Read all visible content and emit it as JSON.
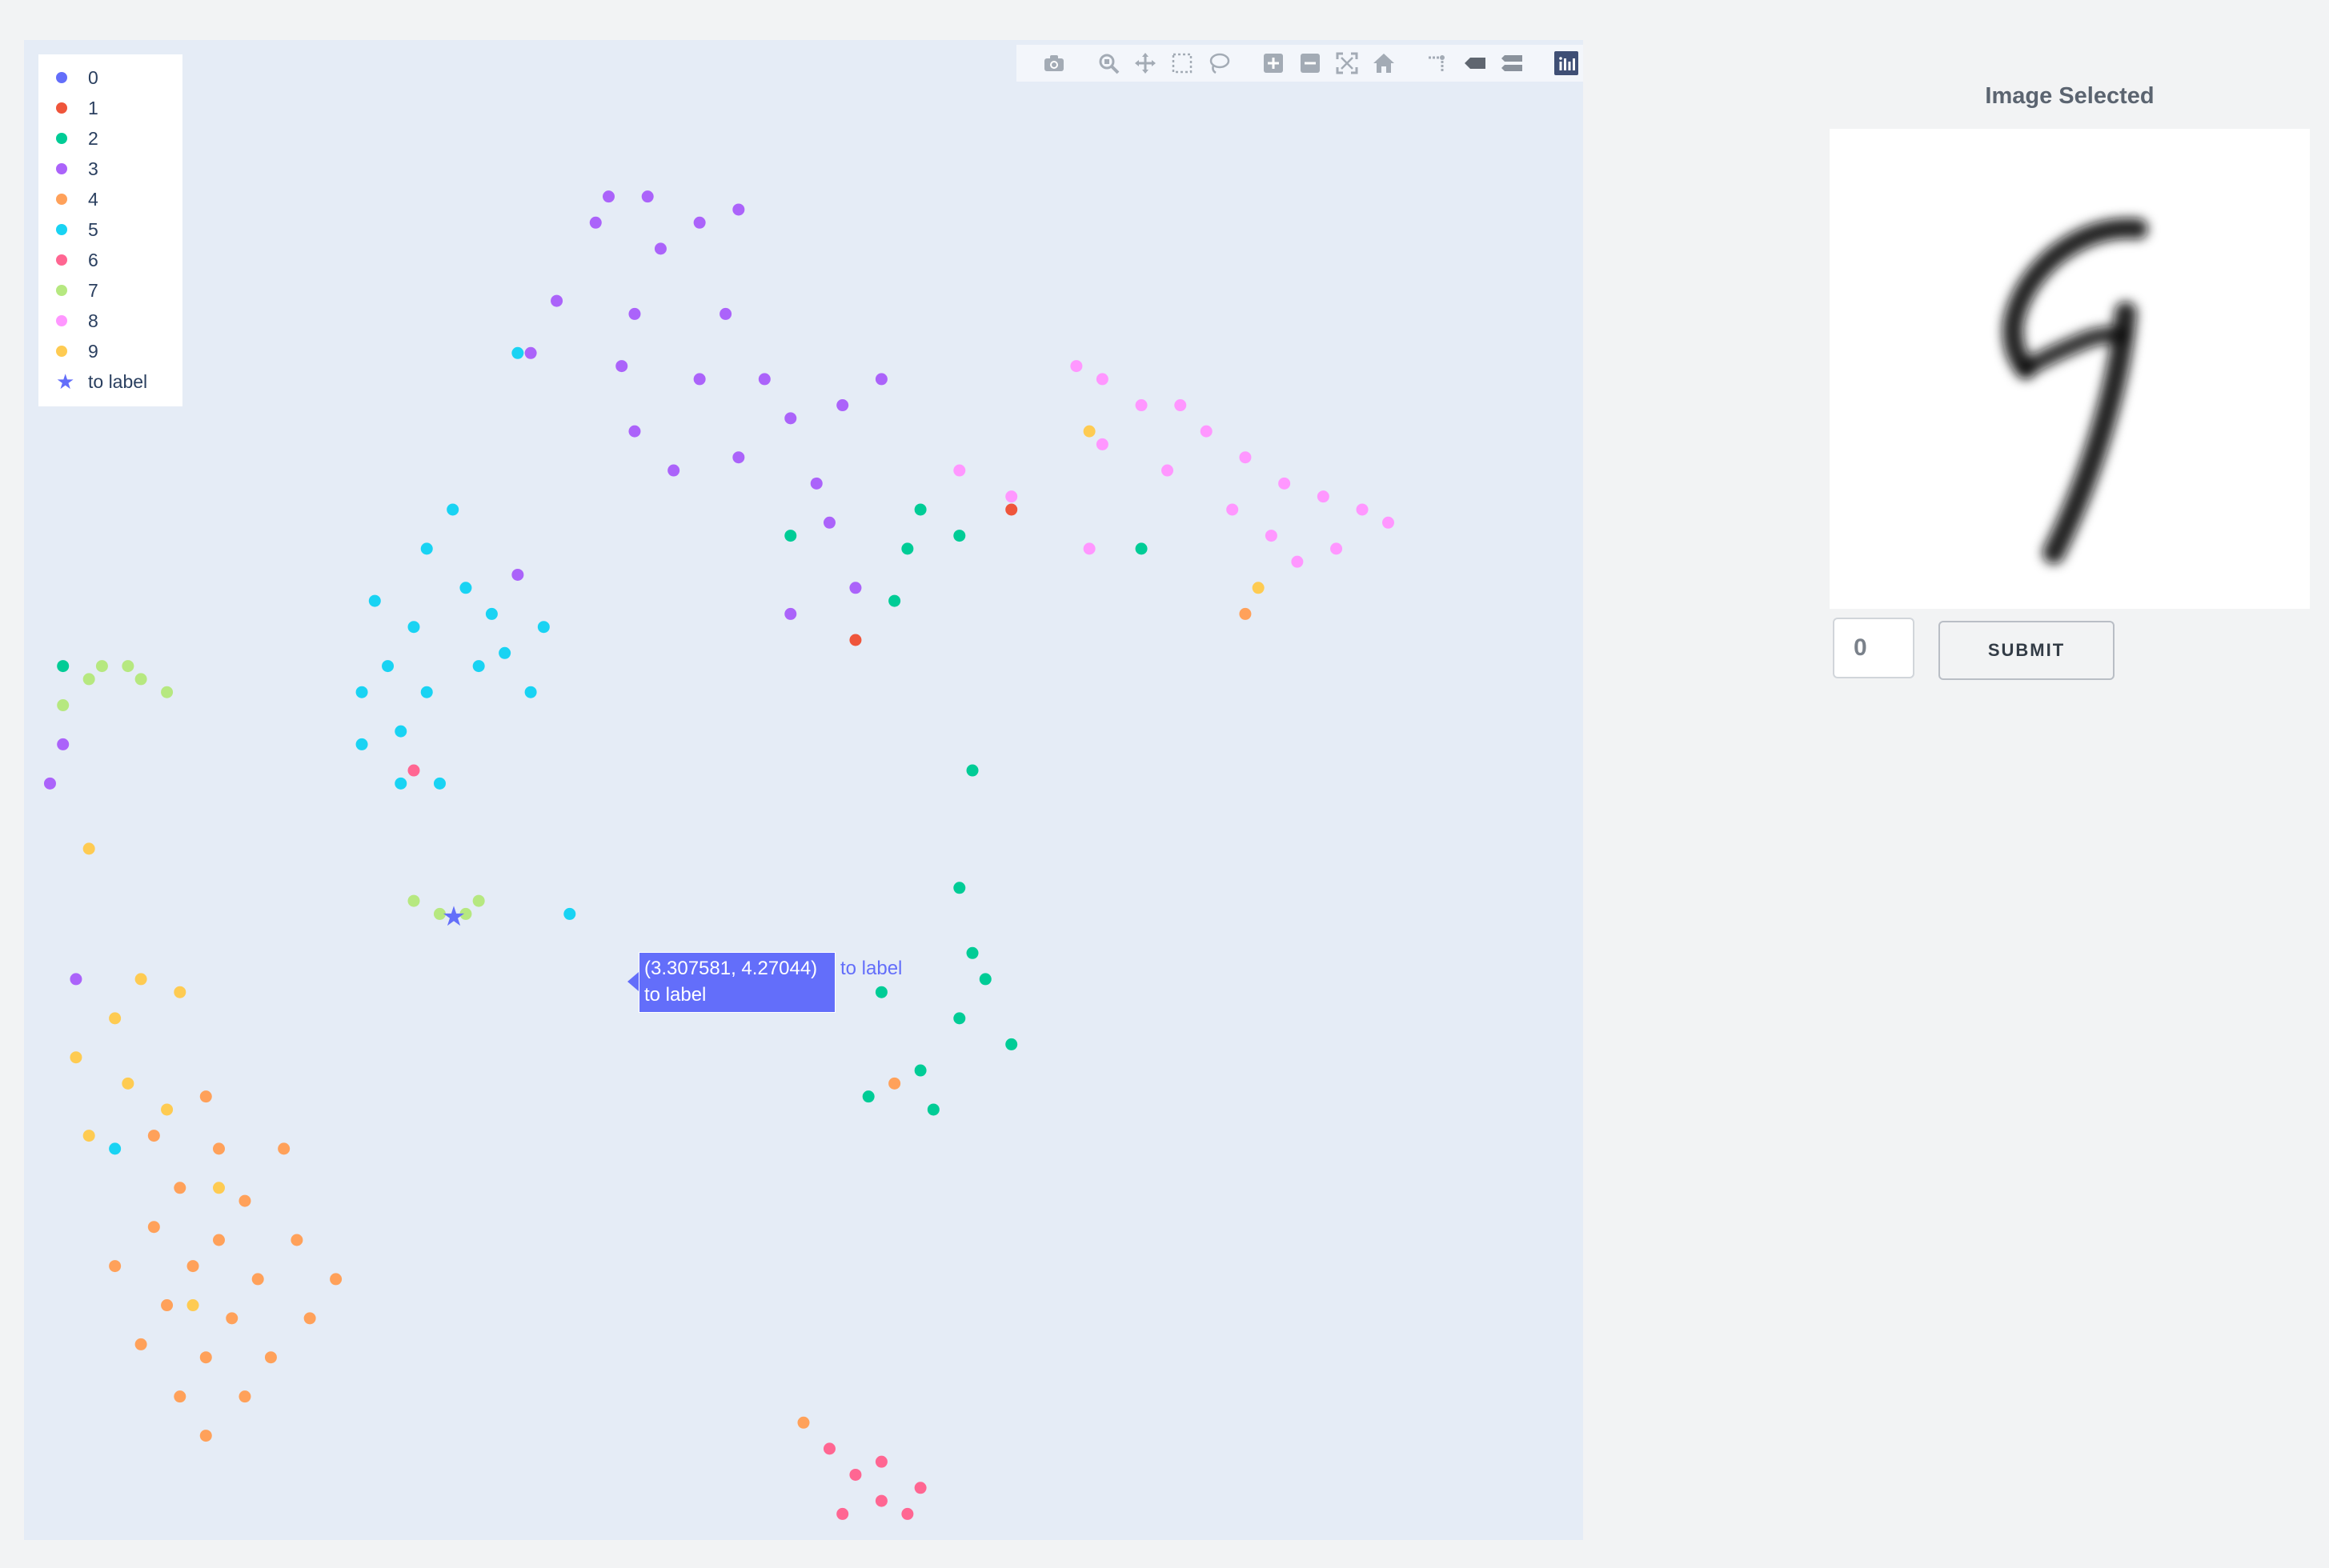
{
  "legend": {
    "items": [
      {
        "label": "0",
        "color": "#636efa",
        "symbol": "dot"
      },
      {
        "label": "1",
        "color": "#ef553b",
        "symbol": "dot"
      },
      {
        "label": "2",
        "color": "#00cc96",
        "symbol": "dot"
      },
      {
        "label": "3",
        "color": "#ab63fa",
        "symbol": "dot"
      },
      {
        "label": "4",
        "color": "#ffa15a",
        "symbol": "dot"
      },
      {
        "label": "5",
        "color": "#19d3f3",
        "symbol": "dot"
      },
      {
        "label": "6",
        "color": "#ff6692",
        "symbol": "dot"
      },
      {
        "label": "7",
        "color": "#b6e880",
        "symbol": "dot"
      },
      {
        "label": "8",
        "color": "#ff97ff",
        "symbol": "dot"
      },
      {
        "label": "9",
        "color": "#fecb52",
        "symbol": "dot"
      },
      {
        "label": "to label",
        "color": "#636efa",
        "symbol": "star"
      }
    ]
  },
  "modebar": {
    "buttons": [
      "camera-icon",
      "zoom-icon",
      "pan-icon",
      "box-select-icon",
      "lasso-select-icon",
      "zoom-in-icon",
      "zoom-out-icon",
      "autoscale-icon",
      "reset-axes-icon",
      "spike-lines-icon",
      "hover-closest-icon",
      "hover-compare-icon",
      "plotly-logo-icon"
    ]
  },
  "hover": {
    "coords": "(3.307581, 4.27044)",
    "line2": "to label",
    "trace_name": "to label"
  },
  "panel": {
    "title": "Image Selected",
    "input_value": "0",
    "submit_label": "SUBMIT"
  },
  "chart_data": {
    "type": "scatter",
    "grid": false,
    "legend_position": "top-left",
    "series": [
      {
        "name": "2",
        "color": "#00cc96",
        "points": [
          [
            0.3,
            6.2
          ],
          [
            5.9,
            7.2
          ],
          [
            6.9,
            7.4
          ],
          [
            7.2,
            7.2
          ],
          [
            6.8,
            7.1
          ],
          [
            8.6,
            7.1
          ],
          [
            6.7,
            6.7
          ],
          [
            7.3,
            5.4
          ],
          [
            7.3,
            4.0
          ],
          [
            7.2,
            4.5
          ],
          [
            7.4,
            3.8
          ],
          [
            7.2,
            3.5
          ],
          [
            7.6,
            3.3
          ],
          [
            6.9,
            3.1
          ],
          [
            6.5,
            2.9
          ],
          [
            5.9,
            3.6
          ],
          [
            6.1,
            3.7
          ],
          [
            6.6,
            3.7
          ],
          [
            7.0,
            2.8
          ]
        ]
      },
      {
        "name": "3",
        "color": "#ab63fa",
        "points": [
          [
            4.5,
            9.8
          ],
          [
            4.8,
            9.8
          ],
          [
            5.5,
            9.7
          ],
          [
            4.4,
            9.6
          ],
          [
            5.2,
            9.6
          ],
          [
            4.9,
            9.4
          ],
          [
            4.1,
            9.0
          ],
          [
            4.7,
            8.9
          ],
          [
            5.4,
            8.9
          ],
          [
            3.9,
            8.6
          ],
          [
            4.6,
            8.5
          ],
          [
            5.2,
            8.4
          ],
          [
            5.7,
            8.4
          ],
          [
            5.9,
            8.1
          ],
          [
            6.6,
            8.4
          ],
          [
            6.3,
            8.2
          ],
          [
            4.7,
            8.0
          ],
          [
            5.0,
            7.7
          ],
          [
            5.5,
            7.8
          ],
          [
            6.1,
            7.6
          ],
          [
            6.2,
            7.3
          ],
          [
            6.4,
            6.8
          ],
          [
            5.9,
            6.6
          ],
          [
            3.8,
            6.9
          ],
          [
            0.3,
            5.6
          ],
          [
            0.2,
            5.3
          ],
          [
            0.4,
            3.8
          ]
        ]
      },
      {
        "name": "5",
        "color": "#19d3f3",
        "points": [
          [
            3.3,
            7.4
          ],
          [
            3.1,
            7.1
          ],
          [
            3.4,
            6.8
          ],
          [
            2.7,
            6.7
          ],
          [
            3.0,
            6.5
          ],
          [
            3.6,
            6.6
          ],
          [
            4.0,
            6.5
          ],
          [
            3.7,
            6.3
          ],
          [
            2.8,
            6.2
          ],
          [
            2.6,
            6.0
          ],
          [
            3.1,
            6.0
          ],
          [
            2.9,
            5.7
          ],
          [
            2.6,
            5.6
          ],
          [
            3.2,
            5.3
          ],
          [
            2.9,
            5.3
          ],
          [
            3.5,
            6.2
          ],
          [
            3.9,
            6.0
          ],
          [
            3.8,
            8.6
          ],
          [
            4.2,
            4.3
          ],
          [
            0.7,
            2.5
          ]
        ]
      },
      {
        "name": "6",
        "color": "#ff6692",
        "points": [
          [
            6.2,
            0.2
          ],
          [
            6.4,
            0.0
          ],
          [
            6.6,
            -0.2
          ],
          [
            6.8,
            -0.3
          ],
          [
            6.9,
            -0.1
          ],
          [
            6.6,
            0.1
          ],
          [
            6.3,
            -0.3
          ],
          [
            3.0,
            5.4
          ]
        ]
      },
      {
        "name": "7",
        "color": "#b6e880",
        "points": [
          [
            0.3,
            5.9
          ],
          [
            0.5,
            6.1
          ],
          [
            0.6,
            6.2
          ],
          [
            0.8,
            6.2
          ],
          [
            0.9,
            6.1
          ],
          [
            1.1,
            6.0
          ],
          [
            3.0,
            4.4
          ],
          [
            3.2,
            4.3
          ],
          [
            3.4,
            4.3
          ],
          [
            3.5,
            4.4
          ]
        ]
      },
      {
        "name": "8",
        "color": "#ff97ff",
        "points": [
          [
            8.1,
            8.5
          ],
          [
            8.3,
            8.4
          ],
          [
            8.6,
            8.2
          ],
          [
            8.9,
            8.2
          ],
          [
            9.1,
            8.0
          ],
          [
            9.4,
            7.8
          ],
          [
            9.7,
            7.6
          ],
          [
            10.0,
            7.5
          ],
          [
            10.3,
            7.4
          ],
          [
            10.5,
            7.3
          ],
          [
            8.3,
            7.9
          ],
          [
            8.8,
            7.7
          ],
          [
            9.3,
            7.4
          ],
          [
            9.6,
            7.2
          ],
          [
            10.1,
            7.1
          ],
          [
            8.2,
            7.1
          ],
          [
            9.8,
            7.0
          ],
          [
            7.2,
            7.7
          ],
          [
            7.6,
            7.5
          ]
        ]
      },
      {
        "name": "9",
        "color": "#fecb52",
        "points": [
          [
            0.5,
            4.8
          ],
          [
            0.9,
            3.8
          ],
          [
            1.2,
            3.7
          ],
          [
            0.7,
            3.5
          ],
          [
            0.4,
            3.2
          ],
          [
            0.8,
            3.0
          ],
          [
            1.1,
            2.8
          ],
          [
            0.5,
            2.6
          ],
          [
            1.5,
            2.2
          ],
          [
            8.2,
            8.0
          ],
          [
            9.5,
            6.8
          ],
          [
            1.3,
            1.3
          ]
        ]
      },
      {
        "name": "4",
        "color": "#ffa15a",
        "points": [
          [
            1.4,
            2.9
          ],
          [
            1.0,
            2.6
          ],
          [
            1.5,
            2.5
          ],
          [
            2.0,
            2.5
          ],
          [
            1.2,
            2.2
          ],
          [
            1.7,
            2.1
          ],
          [
            1.0,
            1.9
          ],
          [
            1.5,
            1.8
          ],
          [
            2.1,
            1.8
          ],
          [
            0.7,
            1.6
          ],
          [
            1.3,
            1.6
          ],
          [
            1.8,
            1.5
          ],
          [
            2.4,
            1.5
          ],
          [
            1.1,
            1.3
          ],
          [
            1.6,
            1.2
          ],
          [
            2.2,
            1.2
          ],
          [
            0.9,
            1.0
          ],
          [
            1.4,
            0.9
          ],
          [
            1.9,
            0.9
          ],
          [
            1.2,
            0.6
          ],
          [
            1.7,
            0.6
          ],
          [
            1.4,
            0.3
          ],
          [
            6.0,
            0.4
          ],
          [
            6.7,
            3.0
          ],
          [
            9.4,
            6.6
          ]
        ]
      },
      {
        "name": "1",
        "color": "#ef553b",
        "points": [
          [
            6.4,
            6.4
          ],
          [
            7.6,
            7.4
          ]
        ]
      },
      {
        "name": "to label",
        "color": "#636efa",
        "marker": "star",
        "points": [
          [
            3.307581,
            4.27044
          ]
        ]
      }
    ]
  }
}
